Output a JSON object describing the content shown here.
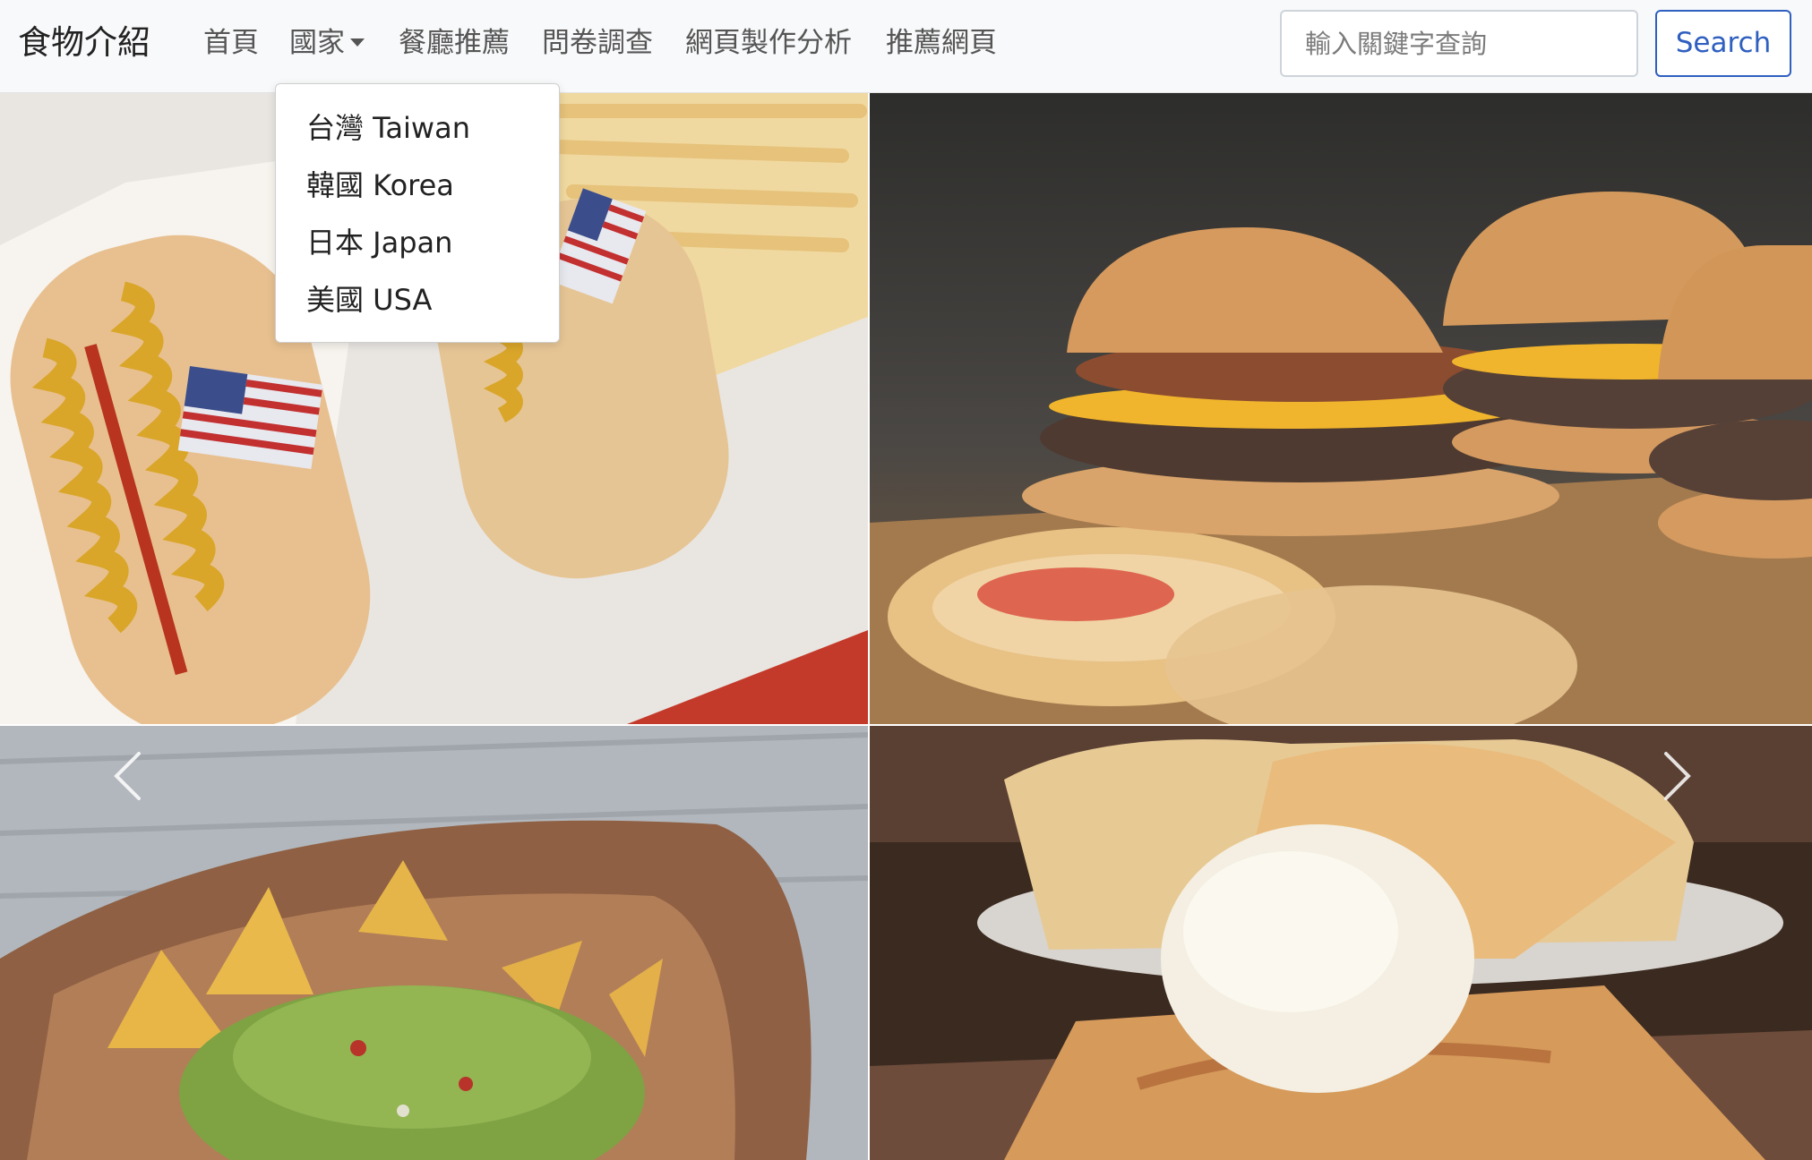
{
  "navbar": {
    "brand": "食物介紹",
    "links": [
      {
        "label": "首頁"
      },
      {
        "label": "國家"
      },
      {
        "label": "餐廳推薦"
      },
      {
        "label": "問卷調查"
      },
      {
        "label": "網頁製作分析"
      },
      {
        "label": "推薦網頁"
      }
    ],
    "search_placeholder": "輸入關鍵字查詢",
    "search_button": "Search"
  },
  "dropdown": {
    "items": [
      {
        "label": "台灣 Taiwan"
      },
      {
        "label": "韓國 Korea"
      },
      {
        "label": "日本 Japan"
      },
      {
        "label": "美國 USA"
      }
    ]
  },
  "gallery": {
    "images": [
      {
        "subject": "hot-dogs-with-american-flags"
      },
      {
        "subject": "cheeseburgers-on-wooden-board"
      },
      {
        "subject": "guacamole-with-tortilla-chips"
      },
      {
        "subject": "apple-pie-with-vanilla-ice-cream"
      }
    ]
  },
  "carousel": {
    "prev_icon": "chevron-left-icon",
    "next_icon": "chevron-right-icon"
  }
}
